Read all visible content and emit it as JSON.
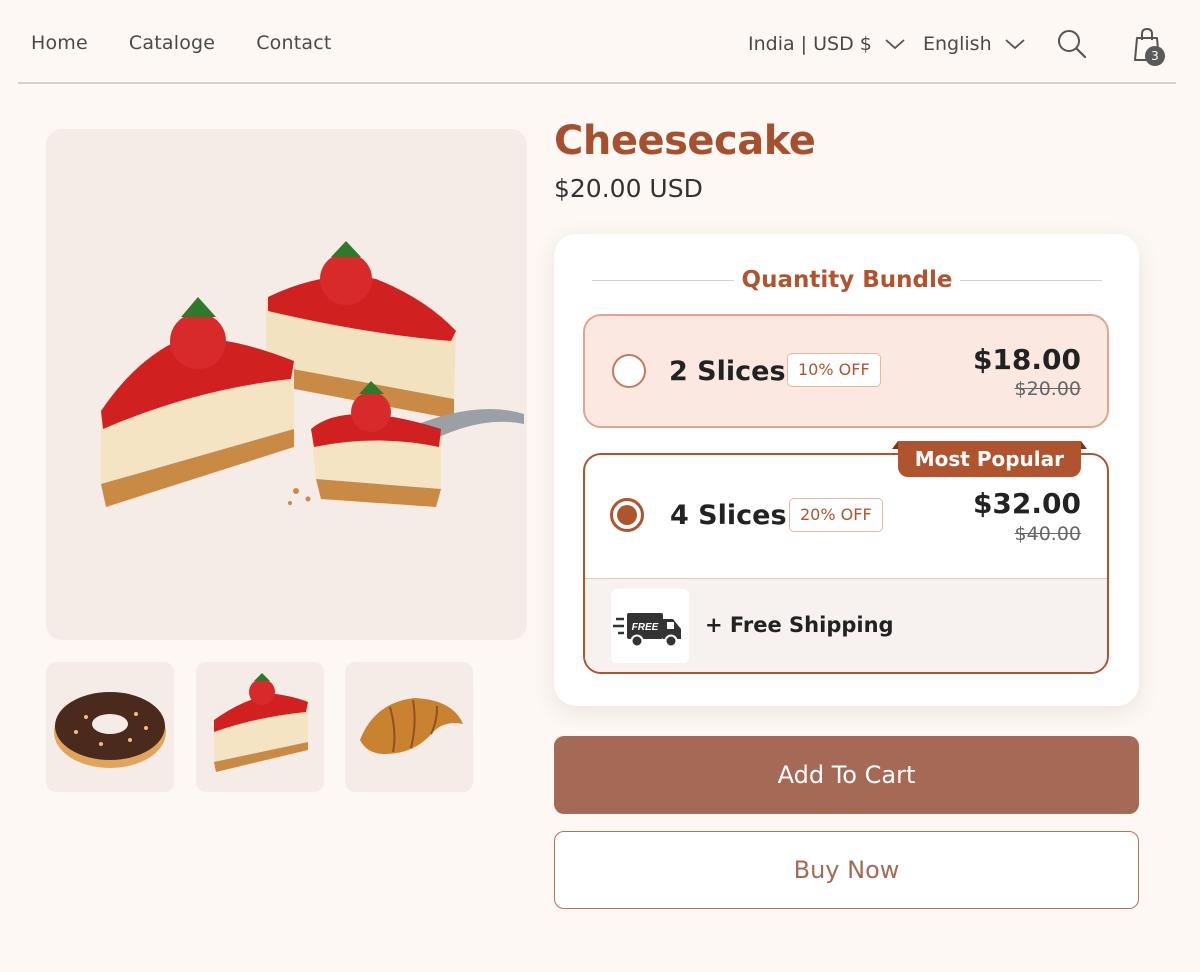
{
  "header": {
    "nav": [
      {
        "label": "Home"
      },
      {
        "label": "Cataloge"
      },
      {
        "label": "Contact"
      }
    ],
    "country_selector": "India | USD $",
    "language_selector": "English",
    "cart_count": "3",
    "icons": [
      "search-icon",
      "shopping-bag-icon",
      "chevron-down-icon"
    ]
  },
  "gallery": {
    "main_image": "cheesecake-slices",
    "thumbnails": [
      "chocolate-donut",
      "cheesecake-slice",
      "croissant"
    ]
  },
  "product": {
    "title": "Cheesecake",
    "price": "$20.00 USD"
  },
  "bundle": {
    "heading": "Quantity Bundle",
    "options": [
      {
        "label": "2 Slices",
        "badge": "10% OFF",
        "price": "$18.00",
        "compare_price": "$20.00",
        "selected": false
      },
      {
        "label": "4 Slices",
        "badge": "20% OFF",
        "price": "$32.00",
        "compare_price": "$40.00",
        "selected": true,
        "ribbon": "Most Popular",
        "perk_icon_text": "FREE",
        "perk": "+ Free Shipping"
      }
    ]
  },
  "actions": {
    "add_to_cart": "Add To Cart",
    "buy_now": "Buy Now"
  },
  "colors": {
    "accent": "#b0542f",
    "button": "#a56a55",
    "background": "#fdf8f4"
  }
}
